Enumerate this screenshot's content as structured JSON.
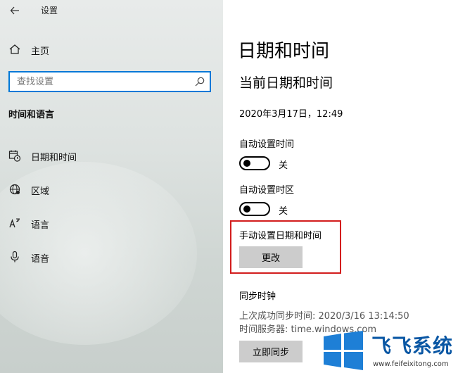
{
  "window": {
    "title": "设置"
  },
  "sidebar": {
    "home_label": "主页",
    "search_placeholder": "查找设置",
    "section_title": "时间和语言",
    "items": [
      {
        "label": "日期和时间",
        "icon": "calendar-clock-icon"
      },
      {
        "label": "区域",
        "icon": "globe-icon"
      },
      {
        "label": "语言",
        "icon": "language-icon"
      },
      {
        "label": "语音",
        "icon": "microphone-icon"
      }
    ]
  },
  "main": {
    "page_title": "日期和时间",
    "section_current": "当前日期和时间",
    "current_datetime": "2020年3月17日，12:49",
    "auto_time": {
      "label": "自动设置时间",
      "state": "关"
    },
    "auto_timezone": {
      "label": "自动设置时区",
      "state": "关"
    },
    "manual": {
      "label": "手动设置日期和时间",
      "button": "更改"
    },
    "sync": {
      "title": "同步时钟",
      "last_sync": "上次成功同步时间: 2020/3/16 13:14:50",
      "server": "时间服务器: time.windows.com",
      "button": "立即同步"
    }
  },
  "watermark": {
    "text": "飞飞系统",
    "url": "www.feifeixitong.com"
  },
  "colors": {
    "accent": "#0078d7",
    "highlight": "#d31d1d",
    "button_bg": "#cccccc"
  }
}
